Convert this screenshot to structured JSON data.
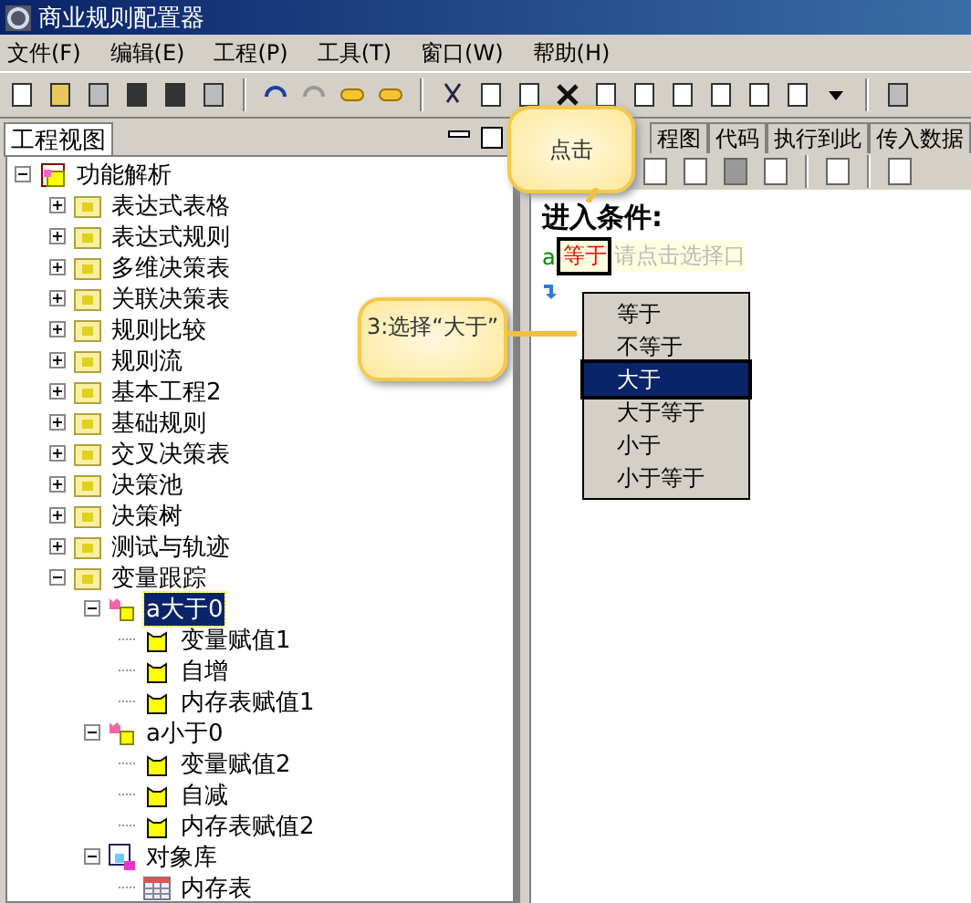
{
  "window": {
    "title": "商业规则配置器"
  },
  "menu": [
    "文件(F)",
    "编辑(E)",
    "工程(P)",
    "工具(T)",
    "窗口(W)",
    "帮助(H)"
  ],
  "left_panel": {
    "tab": "工程视图",
    "tree": [
      {
        "label": "功能解析",
        "kind": "project",
        "expanded": true,
        "selected": false,
        "children": [
          {
            "label": "表达式表格",
            "kind": "folder",
            "expanded": false,
            "selected": false
          },
          {
            "label": "表达式规则",
            "kind": "folder",
            "expanded": false,
            "selected": false
          },
          {
            "label": "多维决策表",
            "kind": "folder",
            "expanded": false,
            "selected": false
          },
          {
            "label": "关联决策表",
            "kind": "folder",
            "expanded": false,
            "selected": false
          },
          {
            "label": "规则比较",
            "kind": "folder",
            "expanded": false,
            "selected": false
          },
          {
            "label": "规则流",
            "kind": "folder",
            "expanded": false,
            "selected": false
          },
          {
            "label": "基本工程2",
            "kind": "folder",
            "expanded": false,
            "selected": false
          },
          {
            "label": "基础规则",
            "kind": "folder",
            "expanded": false,
            "selected": false
          },
          {
            "label": "交叉决策表",
            "kind": "folder",
            "expanded": false,
            "selected": false
          },
          {
            "label": "决策池",
            "kind": "folder",
            "expanded": false,
            "selected": false
          },
          {
            "label": "决策树",
            "kind": "folder",
            "expanded": false,
            "selected": false
          },
          {
            "label": "测试与轨迹",
            "kind": "folder",
            "expanded": false,
            "selected": false
          },
          {
            "label": "变量跟踪",
            "kind": "folder",
            "expanded": true,
            "selected": false,
            "children": [
              {
                "label": "a大于0",
                "kind": "branch",
                "expanded": true,
                "selected": true,
                "children": [
                  {
                    "label": "变量赋值1",
                    "kind": "rule",
                    "selected": false
                  },
                  {
                    "label": "自增",
                    "kind": "rule",
                    "selected": false
                  },
                  {
                    "label": "内存表赋值1",
                    "kind": "rule",
                    "selected": false
                  }
                ]
              },
              {
                "label": "a小于0",
                "kind": "branch",
                "expanded": true,
                "selected": false,
                "children": [
                  {
                    "label": "变量赋值2",
                    "kind": "rule",
                    "selected": false
                  },
                  {
                    "label": "自减",
                    "kind": "rule",
                    "selected": false
                  },
                  {
                    "label": "内存表赋值2",
                    "kind": "rule",
                    "selected": false
                  }
                ]
              },
              {
                "label": "对象库",
                "kind": "objects",
                "expanded": true,
                "selected": false,
                "children": [
                  {
                    "label": "内存表",
                    "kind": "table",
                    "selected": false
                  }
                ]
              }
            ]
          }
        ]
      }
    ]
  },
  "right_panel": {
    "tabs": [
      {
        "label": "程图",
        "selected": false
      },
      {
        "label": "代码",
        "selected": false
      },
      {
        "label": "执行到此",
        "selected": false
      },
      {
        "label": "传入数据",
        "selected": false
      }
    ],
    "heading": "进入条件:",
    "condition": {
      "variable": "a",
      "operator": "等于",
      "placeholder": "请点击选择口"
    },
    "dropdown": [
      {
        "label": "等于",
        "selected": false
      },
      {
        "label": "不等于",
        "selected": false
      },
      {
        "label": "大于",
        "selected": true
      },
      {
        "label": "大于等于",
        "selected": false
      },
      {
        "label": "小于",
        "selected": false
      },
      {
        "label": "小于等于",
        "selected": false
      }
    ]
  },
  "callouts": [
    {
      "kind": "click",
      "text": "点击"
    },
    {
      "kind": "choose",
      "text": "3:选择“大于”"
    }
  ]
}
